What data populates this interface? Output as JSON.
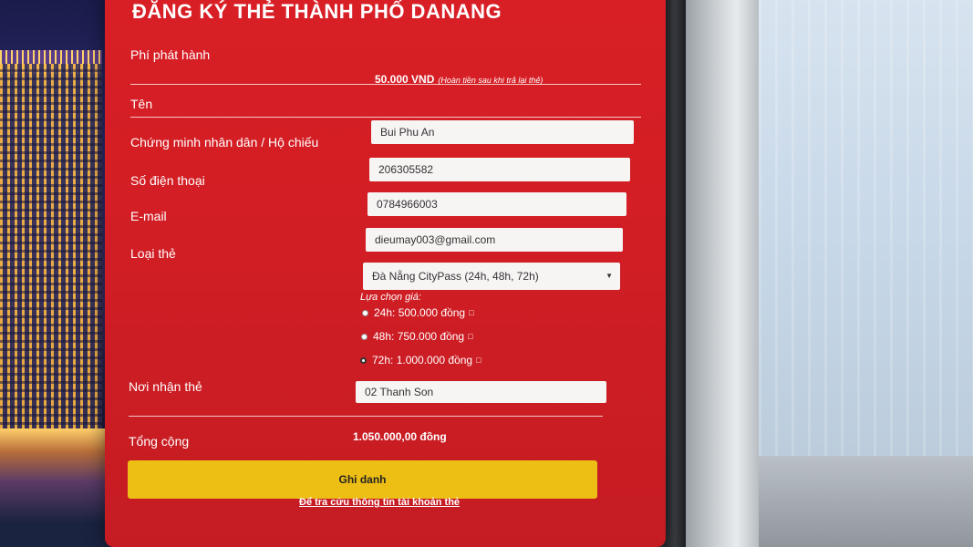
{
  "form": {
    "title": "ĐĂNG KÝ THẺ THÀNH PHỐ DANANG",
    "fee_label": "Phí phát hành",
    "fee_amount": "50.000 VND",
    "fee_note": "(Hoàn tiền sau khi trả lại thẻ)",
    "name_label": "Tên",
    "name_value": "Bui Phu An",
    "id_label": "Chứng minh nhân dân / Hộ chiếu",
    "id_value": "206305582",
    "phone_label": "Số điện thoại",
    "phone_value": "0784966003",
    "email_label": "E-mail",
    "email_value": "dieumay003@gmail.com",
    "card_type_label": "Loại thẻ",
    "card_type_value": "Đà Nẵng CityPass (24h, 48h, 72h)",
    "price_choice_label": "Lựa chọn giá:",
    "price_options": [
      {
        "label": "24h: 500.000 đồng",
        "selected": false
      },
      {
        "label": "48h: 750.000 đồng",
        "selected": false
      },
      {
        "label": "72h: 1.000.000 đồng",
        "selected": true
      }
    ],
    "pickup_label": "Nơi nhận thẻ",
    "pickup_value": "02 Thanh Son",
    "total_label": "Tổng cộng",
    "total_value": "1.050.000,00 đồng",
    "submit_label": "Ghi danh",
    "lookup_link": "Để tra cứu thông tin tài khoản thẻ"
  },
  "colors": {
    "panel": "#d21e24",
    "button": "#edbe14"
  },
  "icons": {
    "select_arrow": "chevron-down-icon",
    "option_box": "□"
  }
}
